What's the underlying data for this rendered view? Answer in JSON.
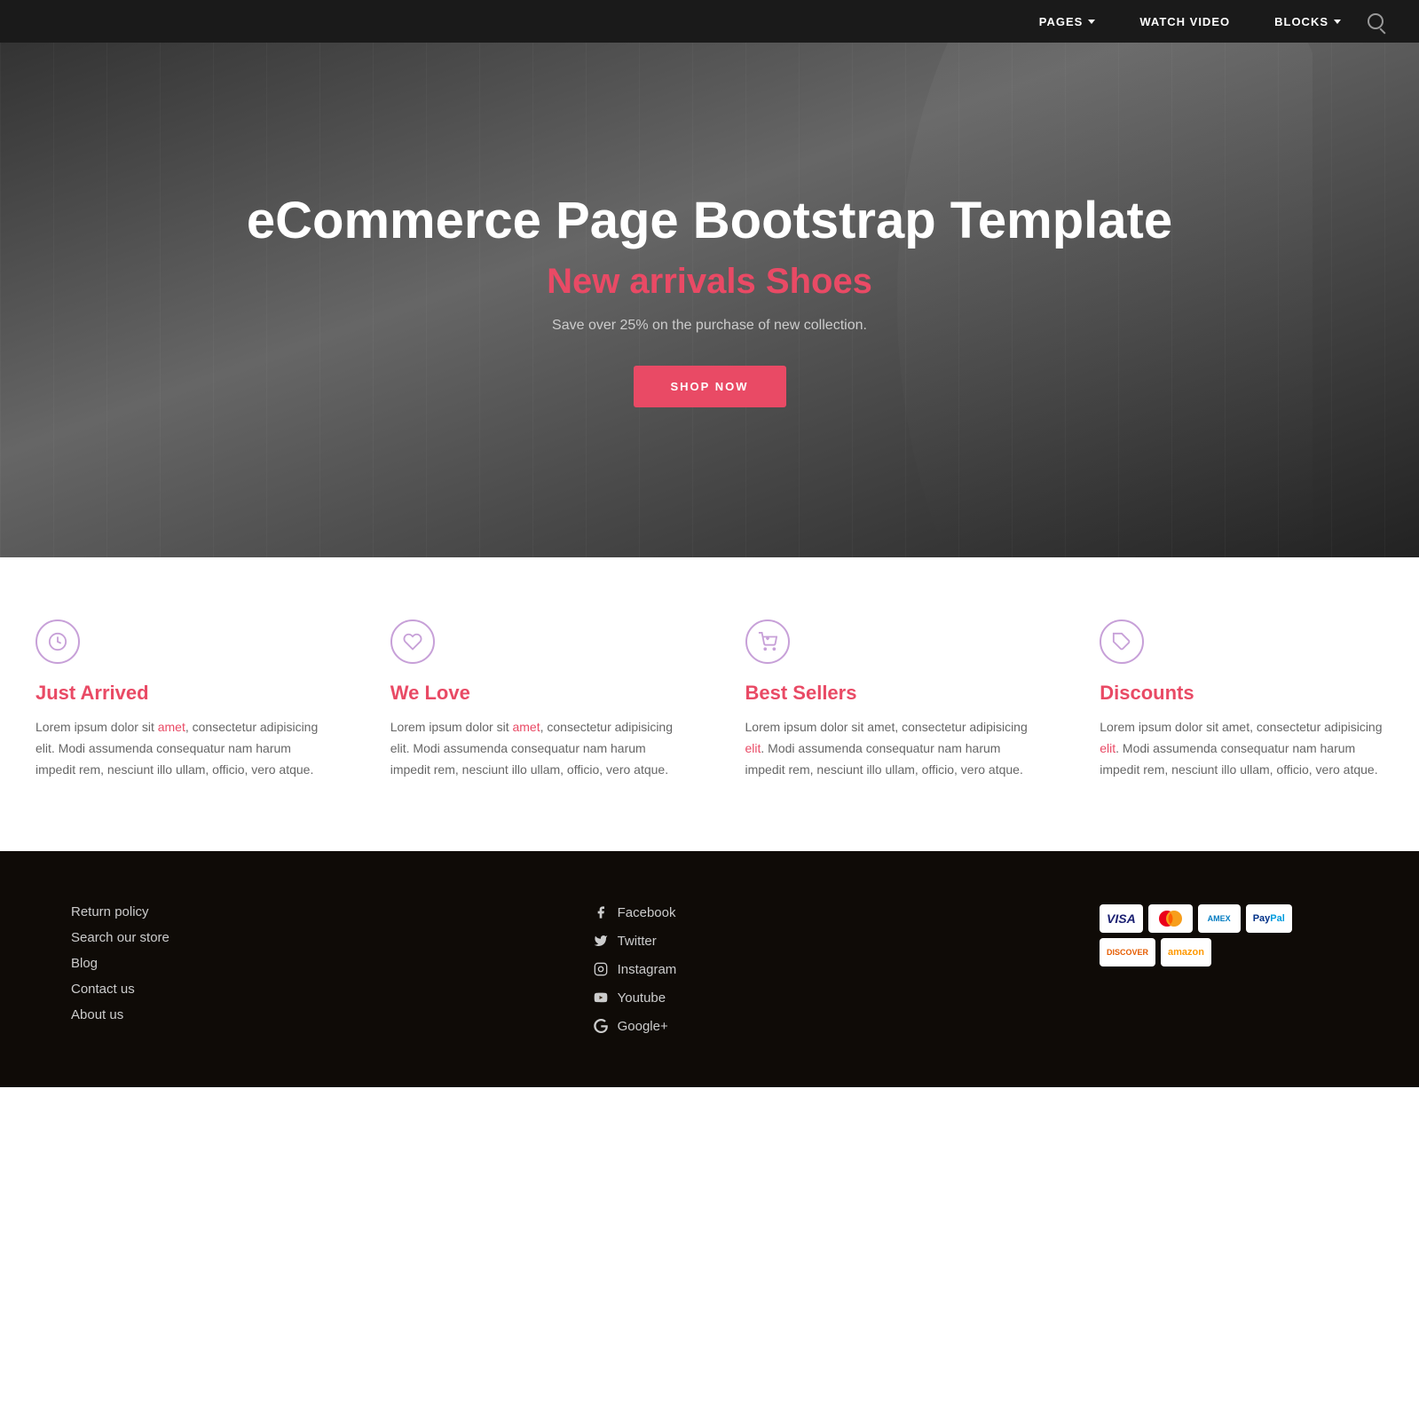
{
  "navbar": {
    "items": [
      {
        "label": "PAGES",
        "has_caret": true,
        "id": "pages"
      },
      {
        "label": "WATCH VIDEO",
        "has_caret": false,
        "id": "watch-video"
      },
      {
        "label": "BLOCKS",
        "has_caret": true,
        "id": "blocks"
      }
    ]
  },
  "hero": {
    "title": "eCommerce Page Bootstrap Template",
    "subtitle_plain": "New arrivals ",
    "subtitle_accent": "Shoes",
    "description": "Save over 25% on the purchase of new collection.",
    "cta_label": "SHOP NOW"
  },
  "features": [
    {
      "id": "just-arrived",
      "icon": "clock",
      "title": "Just Arrived",
      "text": "Lorem ipsum dolor sit amet, consectetur adipisicing elit. Modi assumenda consequatur nam harum impedit rem, nesciunt illo ullam, officio, vero atque.",
      "link_word": "amet"
    },
    {
      "id": "we-love",
      "icon": "heart",
      "title": "We Love",
      "text": "Lorem ipsum dolor sit amet, consectetur adipisicing elit. Modi assumenda consequatur nam harum impedit rem, nesciunt illo ullam, officio, vero atque.",
      "link_word": "amet"
    },
    {
      "id": "best-sellers",
      "icon": "cart",
      "title": "Best Sellers",
      "text": "Lorem ipsum dolor sit amet, consectetur adipisicing elit. Modi assumenda consequatur nam harum impedit rem, nesciunt illo ullam, officio, vero atque.",
      "link_word": "elit"
    },
    {
      "id": "discounts",
      "icon": "tag",
      "title": "Discounts",
      "text": "Lorem ipsum dolor sit amet, consectetur adipisicing elit. Modi assumenda consequatur nam harum impedit rem, nesciunt illo ullam, officio, vero atque.",
      "link_word": "elit"
    }
  ],
  "footer": {
    "links": [
      {
        "label": "Return policy",
        "id": "return-policy"
      },
      {
        "label": "Search our store",
        "id": "search-our-store"
      },
      {
        "label": "Blog",
        "id": "blog"
      },
      {
        "label": "Contact us",
        "id": "contact-us"
      },
      {
        "label": "About us",
        "id": "about-us"
      }
    ],
    "social": [
      {
        "label": "Facebook",
        "icon": "facebook",
        "id": "facebook"
      },
      {
        "label": "Twitter",
        "icon": "twitter",
        "id": "twitter"
      },
      {
        "label": "Instagram",
        "icon": "instagram",
        "id": "instagram"
      },
      {
        "label": "Youtube",
        "icon": "youtube",
        "id": "youtube"
      },
      {
        "label": "Google+",
        "icon": "googleplus",
        "id": "googleplus"
      }
    ],
    "payment_methods": [
      {
        "label": "VISA",
        "style": "visa"
      },
      {
        "label": "MC",
        "style": "mc"
      },
      {
        "label": "AMEX",
        "style": "amex"
      },
      {
        "label": "PayPal",
        "style": "paypal"
      },
      {
        "label": "DISCOVER",
        "style": "discover"
      },
      {
        "label": "amazon",
        "style": "amazon"
      }
    ]
  }
}
